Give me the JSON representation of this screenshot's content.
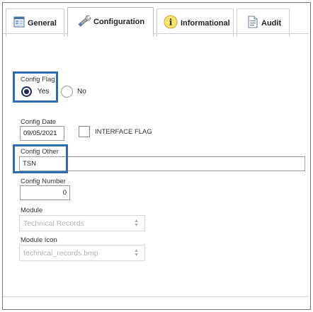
{
  "tabs": [
    {
      "label": "General",
      "icon": "form-icon"
    },
    {
      "label": "Configuration",
      "icon": "wrench-icon",
      "active": true
    },
    {
      "label": "Informational",
      "icon": "info-icon"
    },
    {
      "label": "Audit",
      "icon": "document-icon"
    }
  ],
  "form": {
    "config_flag": {
      "label": "Config Flag",
      "yes_label": "Yes",
      "no_label": "No",
      "value": "Yes"
    },
    "config_date": {
      "label": "Config Date",
      "value": "09/05/2021"
    },
    "interface_flag": {
      "label": "INTERFACE FLAG",
      "checked": false
    },
    "config_other": {
      "label": "Config Other",
      "value": "TSN"
    },
    "config_number": {
      "label": "Config Number",
      "value": "0"
    },
    "module": {
      "label": "Module",
      "value": "Technical Records"
    },
    "module_icon": {
      "label": "Module Icon",
      "value": "technical_records.bmp"
    }
  },
  "colors": {
    "highlight": "#2e6cb4",
    "radio_selected": "#1f2a5a"
  }
}
